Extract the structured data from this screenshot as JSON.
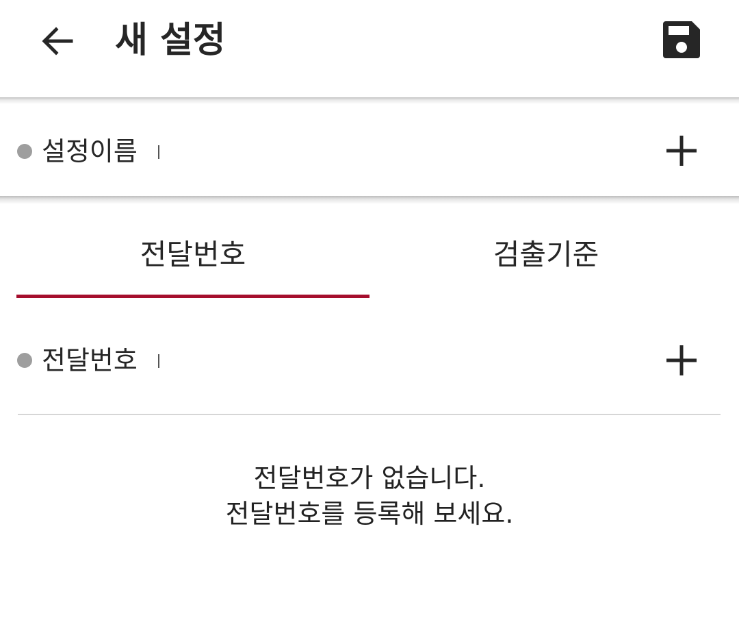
{
  "header": {
    "title": "새 설정",
    "back_icon": "arrow-left-icon",
    "save_icon": "floppy-disk-icon"
  },
  "name_field": {
    "label": "설정이름",
    "add_icon": "plus-icon"
  },
  "tabs": [
    {
      "label": "전달번호",
      "active": true
    },
    {
      "label": "검출기준",
      "active": false
    }
  ],
  "forward_section": {
    "label": "전달번호",
    "add_icon": "plus-icon",
    "empty_line1": "전달번호가 없습니다.",
    "empty_line2": "전달번호를 등록해 보세요."
  },
  "colors": {
    "accent": "#a50e2d",
    "bullet": "#9e9e9e",
    "text": "#262626",
    "divider": "#d6d6d6"
  }
}
